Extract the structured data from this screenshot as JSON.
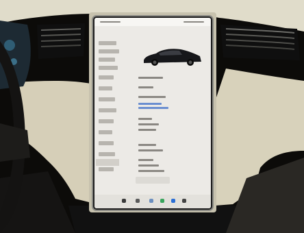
{
  "scene": {
    "description_icons": [
      "steering-wheel",
      "air-vent-left",
      "air-vent-right",
      "touchscreen",
      "car-render"
    ],
    "colors": {
      "dashboard": "#d9d4bf",
      "interior_dark": "#0c0b09",
      "screen_bg": "#eceae6",
      "car": "#16171a",
      "accent_blue": "#6a8ed0"
    }
  }
}
